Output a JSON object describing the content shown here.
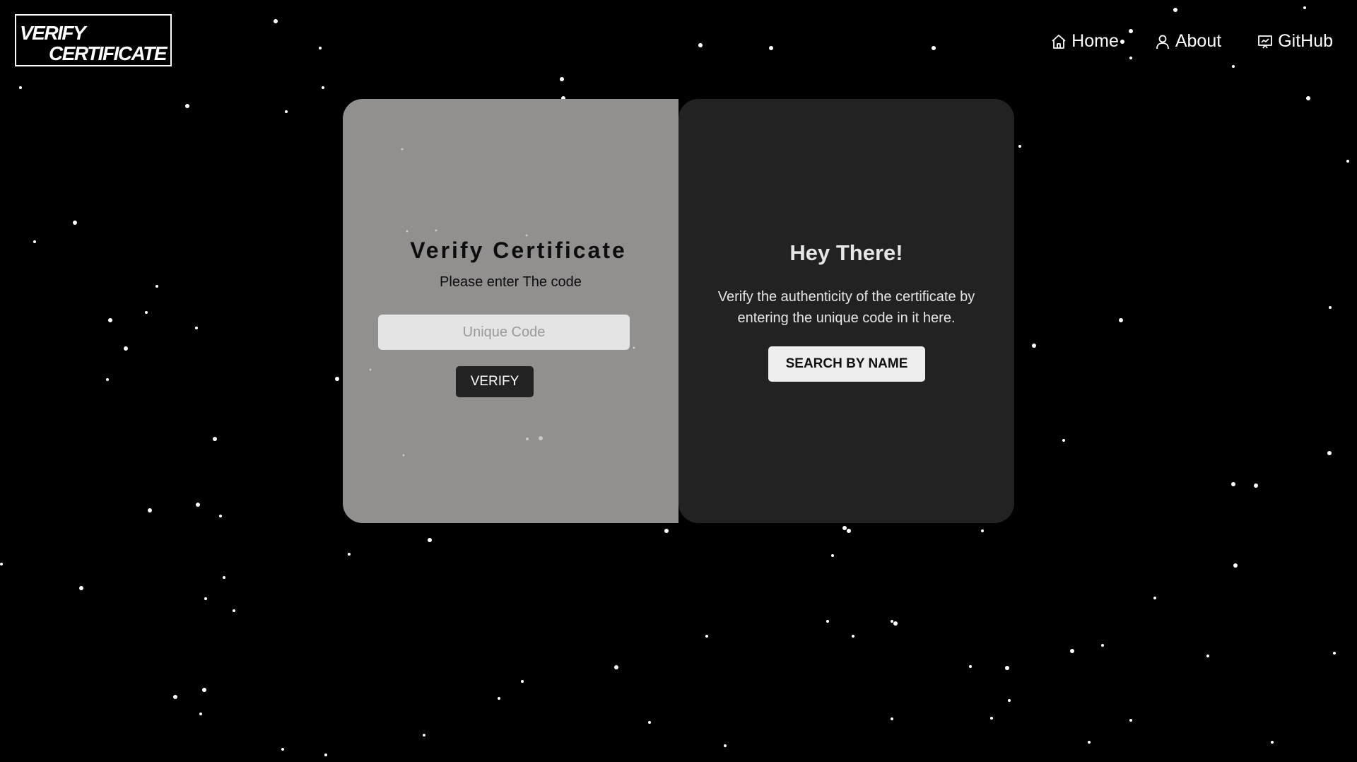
{
  "header": {
    "logo": {
      "line1": "VERIFY",
      "line2": "CERTIFICATE"
    },
    "nav": [
      {
        "label": "Home",
        "icon": "home-icon"
      },
      {
        "label": "About",
        "icon": "user-icon"
      },
      {
        "label": "GitHub",
        "icon": "presentation-icon"
      }
    ]
  },
  "verify_panel": {
    "title": "Verify Certificate",
    "subtitle": "Please enter The code",
    "input_placeholder": "Unique Code",
    "input_value": "",
    "button_label": "VERIFY"
  },
  "info_panel": {
    "title": "Hey There!",
    "text": "Verify the authenticity of the certificate by entering the unique code in it here.",
    "button_label": "SEARCH BY NAME"
  },
  "colors": {
    "background": "#000000",
    "left_panel": "#928f8f",
    "right_panel": "#222222",
    "verify_button": "#222222",
    "search_button": "#eeeeee",
    "star": "#ffffff"
  }
}
